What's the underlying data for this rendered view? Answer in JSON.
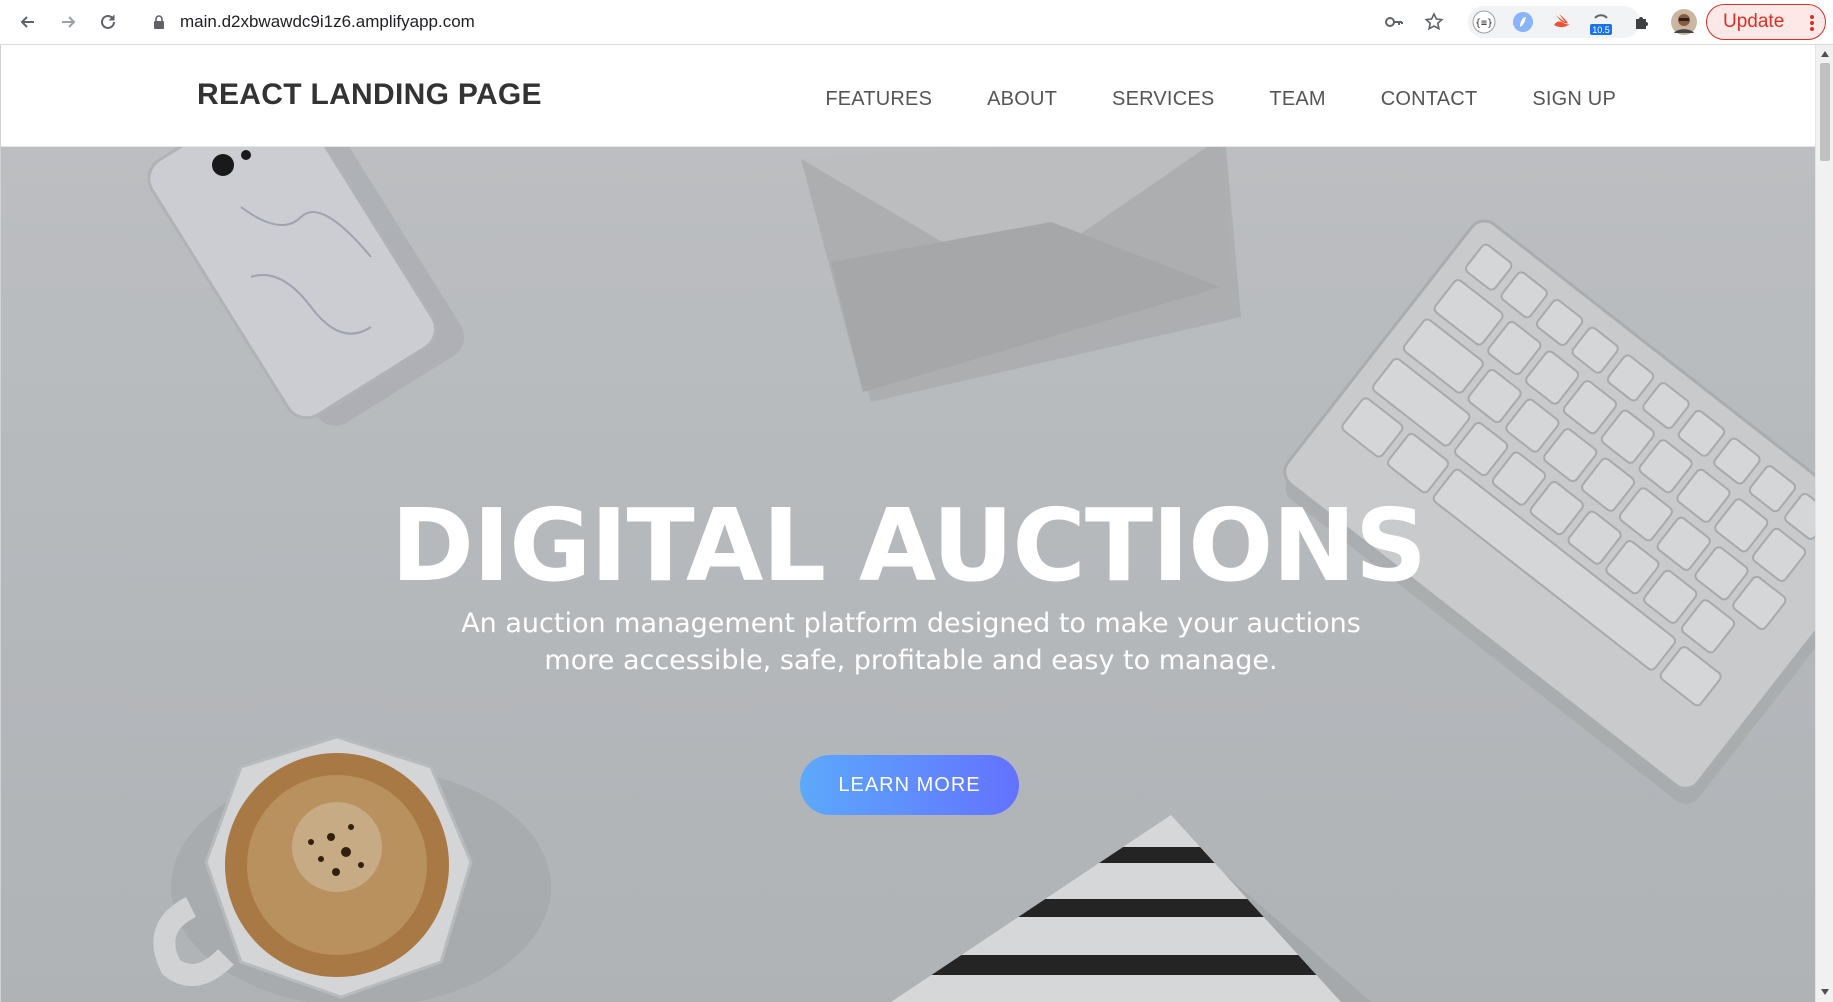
{
  "browser": {
    "url": "main.d2xbwawdc9i1z6.amplifyapp.com",
    "update_label": "Update",
    "extension_badge": "10.5",
    "icons": [
      "back-icon",
      "forward-icon",
      "reload-icon",
      "lock-icon",
      "key-icon",
      "star-icon",
      "json-extension-icon",
      "extension-icon",
      "swift-extension-icon",
      "network-extension-icon",
      "puzzle-icon",
      "profile-avatar",
      "more-icon"
    ]
  },
  "site": {
    "brand": "REACT LANDING PAGE",
    "menu": [
      "FEATURES",
      "ABOUT",
      "SERVICES",
      "TEAM",
      "CONTACT",
      "SIGN UP"
    ]
  },
  "hero": {
    "title": "DIGITAL AUCTIONS",
    "subtitle": "An auction management platform designed to make your auctions more accessible, safe, profitable and easy to manage.",
    "button": "LEARN MORE"
  },
  "colors": {
    "button_gradient_start": "#5ca9fb",
    "button_gradient_end": "#6372ff",
    "update_red": "#d93025",
    "brand_text": "#333333"
  }
}
